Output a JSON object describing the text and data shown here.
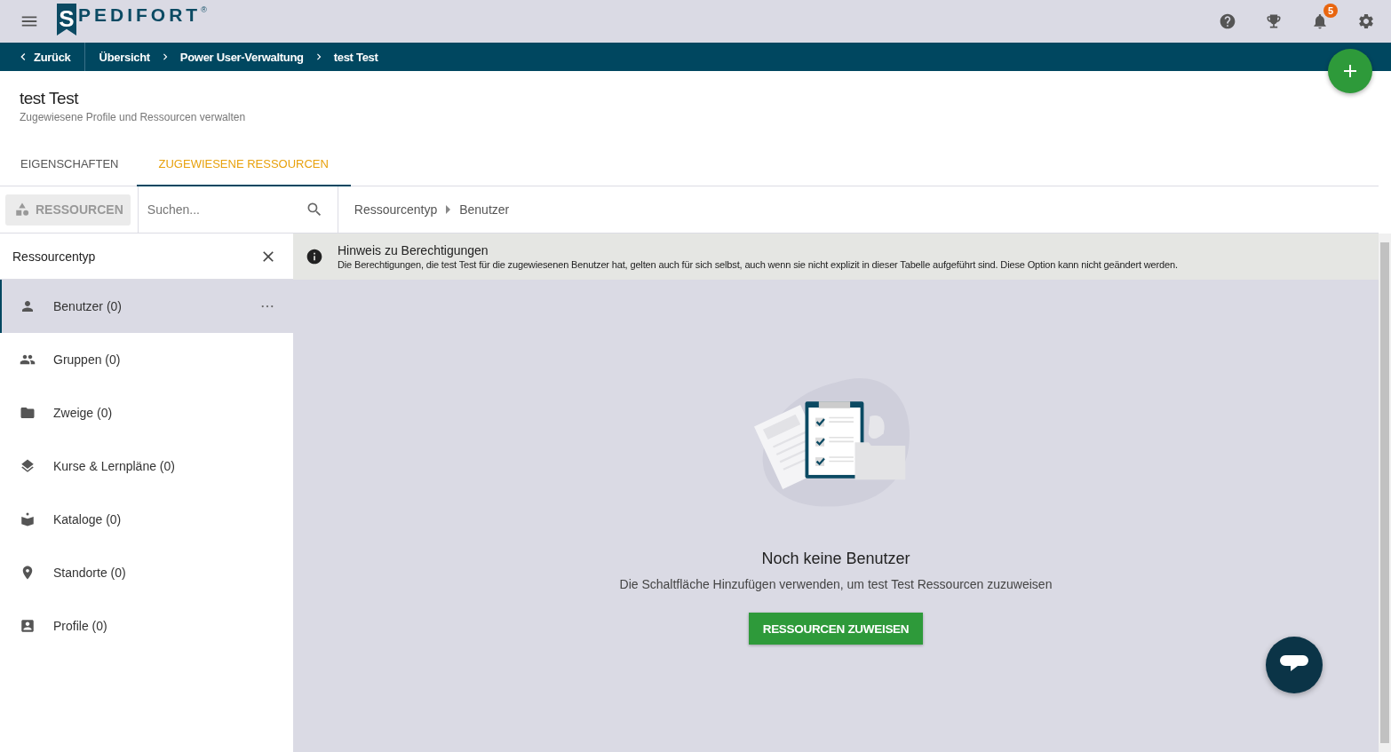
{
  "header": {
    "logo": {
      "initial": "S",
      "name": "PEDIFORT",
      "mark": "®"
    },
    "notification_count": "5"
  },
  "breadcrumb": {
    "back": "Zurück",
    "items": [
      "Übersicht",
      "Power User-Verwaltung",
      "test Test"
    ]
  },
  "page": {
    "title": "test Test",
    "subtitle": "Zugewiesene Profile und Ressourcen verwalten"
  },
  "tabs": [
    {
      "label": "EIGENSCHAFTEN",
      "selected": false
    },
    {
      "label": "ZUGEWIESENE RESSOURCEN",
      "selected": true
    }
  ],
  "toolbar": {
    "filter_button": "RESSOURCEN",
    "search": {
      "placeholder": "Suchen..."
    },
    "path": [
      "Ressourcentyp",
      "Benutzer"
    ]
  },
  "sidebar": {
    "title": "Ressourcentyp",
    "items": [
      {
        "label": "Benutzer (0)",
        "selected": true
      },
      {
        "label": "Gruppen (0)",
        "selected": false
      },
      {
        "label": "Zweige (0)",
        "selected": false
      },
      {
        "label": "Kurse & Lernpläne (0)",
        "selected": false
      },
      {
        "label": "Kataloge (0)",
        "selected": false
      },
      {
        "label": "Standorte (0)",
        "selected": false
      },
      {
        "label": "Profile (0)",
        "selected": false
      }
    ]
  },
  "notice": {
    "title": "Hinweis zu Berechtigungen",
    "text": "Die Berechtigungen, die test Test für die zugewiesenen Benutzer hat, gelten auch für sich selbst, auch wenn sie nicht explizit in dieser Tabelle aufgeführt sind. Diese Option kann nicht geändert werden."
  },
  "empty_state": {
    "title": "Noch keine Benutzer",
    "text": "Die Schaltfläche Hinzufügen verwenden, um test Test Ressourcen zuzuweisen",
    "button": "RESSOURCEN ZUWEISEN"
  }
}
